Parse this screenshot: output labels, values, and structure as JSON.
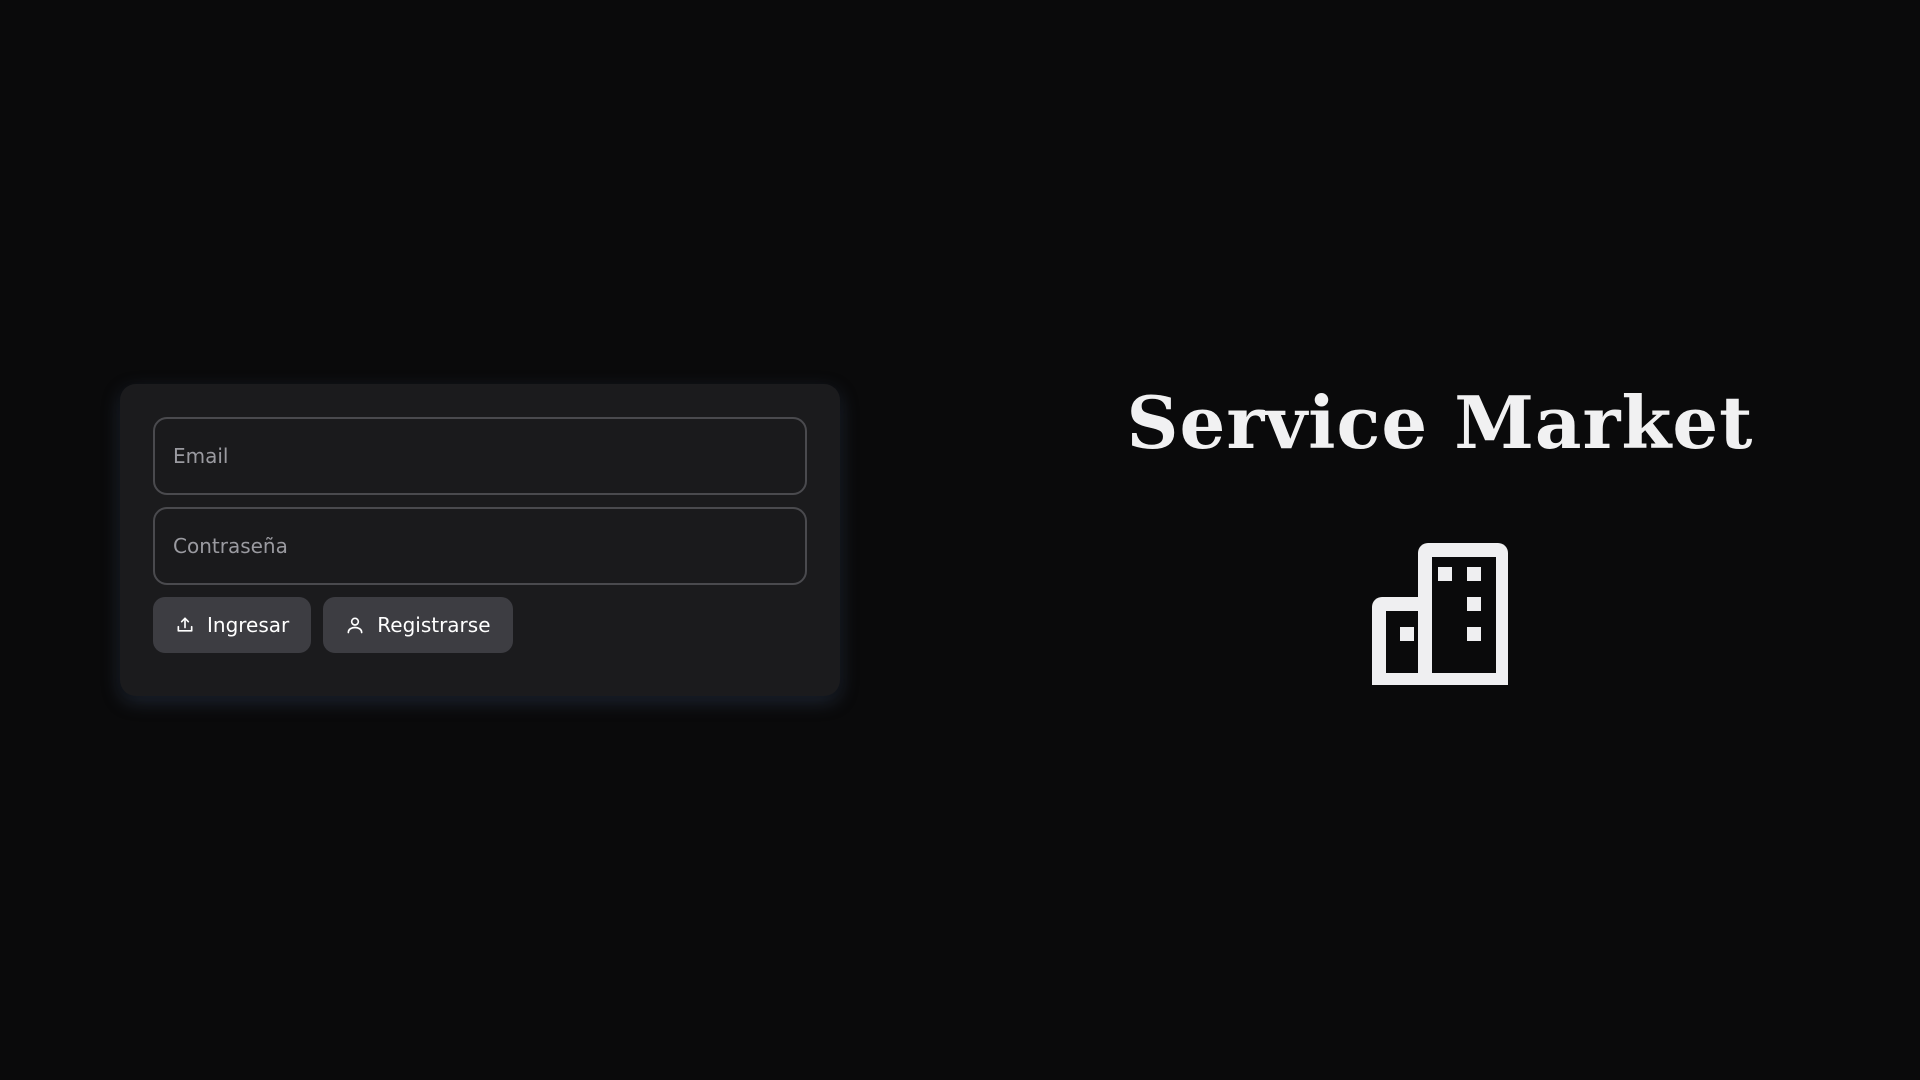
{
  "login": {
    "email_placeholder": "Email",
    "password_placeholder": "Contraseña",
    "login_button": {
      "label": "Ingresar",
      "icon": "upload-icon"
    },
    "register_button": {
      "label": "Registrarse",
      "icon": "user-icon"
    }
  },
  "brand": {
    "title": "Service Market",
    "icon": "building-icon"
  },
  "colors": {
    "background": "#0a0a0b",
    "card": "#1b1b1d",
    "button": "#3d3d42",
    "text": "#f1f1f2"
  }
}
